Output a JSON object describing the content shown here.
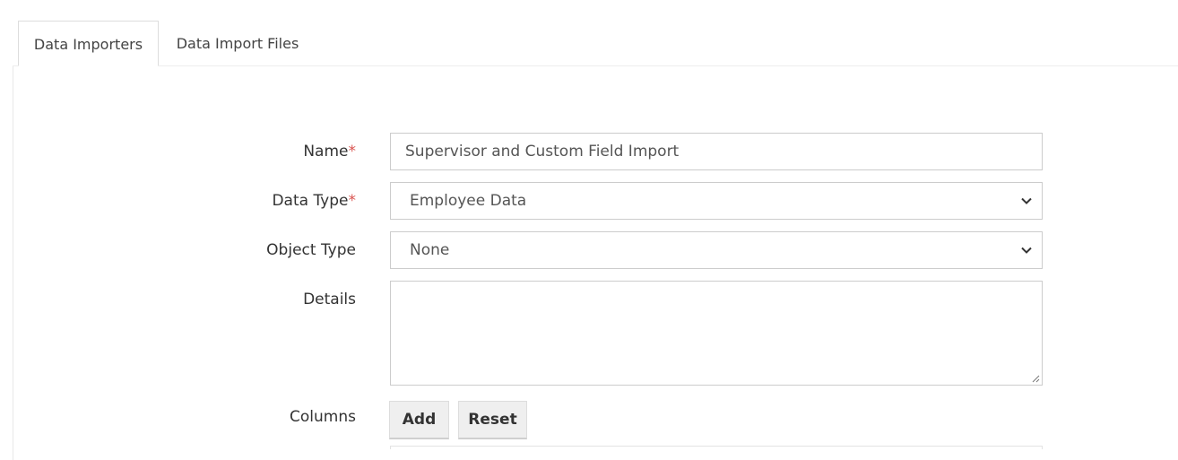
{
  "tabs": [
    {
      "label": "Data Importers",
      "active": true
    },
    {
      "label": "Data Import Files",
      "active": false
    }
  ],
  "form": {
    "name": {
      "label": "Name",
      "required_mark": "*",
      "value": "Supervisor and Custom Field Import"
    },
    "data_type": {
      "label": "Data Type",
      "required_mark": "*",
      "value": "Employee Data"
    },
    "object_type": {
      "label": "Object Type",
      "value": "None"
    },
    "details": {
      "label": "Details",
      "value": ""
    },
    "columns": {
      "label": "Columns",
      "add_label": "Add",
      "reset_label": "Reset"
    }
  },
  "colors": {
    "required": "#d9534f",
    "border": "#cccccc",
    "button_bg": "#efefef"
  },
  "icons": {
    "select_arrow": "chevron-down-icon",
    "textarea_grip": "resize-grip-icon"
  }
}
